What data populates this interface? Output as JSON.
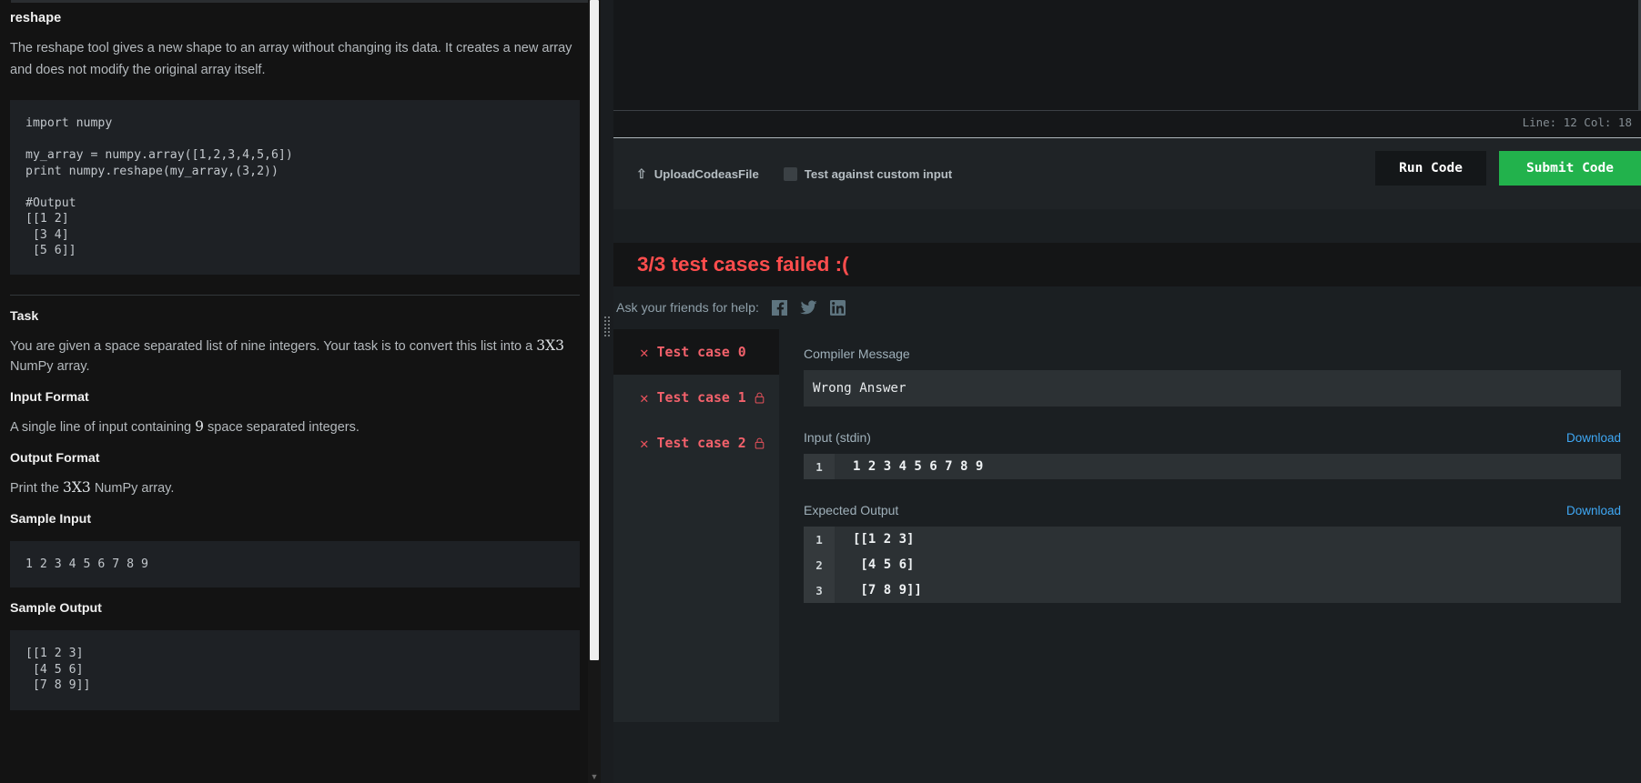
{
  "problem": {
    "title": "reshape",
    "description": "The reshape tool gives a new shape to an array without changing its data. It creates a new array and does not modify the original array itself.",
    "example_code": "import numpy\n\nmy_array = numpy.array([1,2,3,4,5,6])\nprint numpy.reshape(my_array,(3,2))\n\n#Output\n[[1 2]\n [3 4]\n [5 6]]",
    "task_heading": "Task",
    "task_text_a": "You are given a space separated list of nine integers. Your task is to convert this list into a ",
    "task_dim": "3X3",
    "task_text_b": " NumPy array.",
    "input_format_heading": "Input Format",
    "input_format_a": "A single line of input containing ",
    "input_format_num": "9",
    "input_format_b": " space separated integers.",
    "output_format_heading": "Output Format",
    "output_format_a": "Print the ",
    "output_format_dim": "3X3",
    "output_format_b": " NumPy array.",
    "sample_input_heading": "Sample Input",
    "sample_input": "1 2 3 4 5 6 7 8 9",
    "sample_output_heading": "Sample Output",
    "sample_output": "[[1 2 3]\n [4 5 6]\n [7 8 9]]"
  },
  "editor": {
    "cursor_status": "Line: 12 Col: 18"
  },
  "toolbar": {
    "upload_label": "UploadCodeasFile",
    "custom_input_label": "Test against custom input",
    "run_label": "Run Code",
    "submit_label": "Submit Code"
  },
  "results": {
    "banner": "3/3 test cases failed :(",
    "share_label": "Ask your friends for help:",
    "social": [
      {
        "name": "facebook-icon"
      },
      {
        "name": "twitter-icon"
      },
      {
        "name": "linkedin-icon"
      }
    ],
    "cases": [
      {
        "label": "Test case 0",
        "locked": false,
        "status": "failed",
        "active": true
      },
      {
        "label": "Test case 1",
        "locked": true,
        "status": "failed",
        "active": false
      },
      {
        "label": "Test case 2",
        "locked": true,
        "status": "failed",
        "active": false
      }
    ],
    "compiler_message_label": "Compiler Message",
    "compiler_message": "Wrong Answer",
    "input_label": "Input (stdin)",
    "input_download": "Download",
    "input_lines": [
      {
        "n": "1",
        "text": "1 2 3 4 5 6 7 8 9"
      }
    ],
    "expected_label": "Expected Output",
    "expected_download": "Download",
    "expected_lines": [
      {
        "n": "1",
        "text": "[[1 2 3]"
      },
      {
        "n": "2",
        "text": " [4 5 6]"
      },
      {
        "n": "3",
        "text": " [7 8 9]]"
      }
    ]
  },
  "colors": {
    "fail_red": "#ff4d4d",
    "submit_green": "#22b24c",
    "link_blue": "#3fa8f5"
  }
}
